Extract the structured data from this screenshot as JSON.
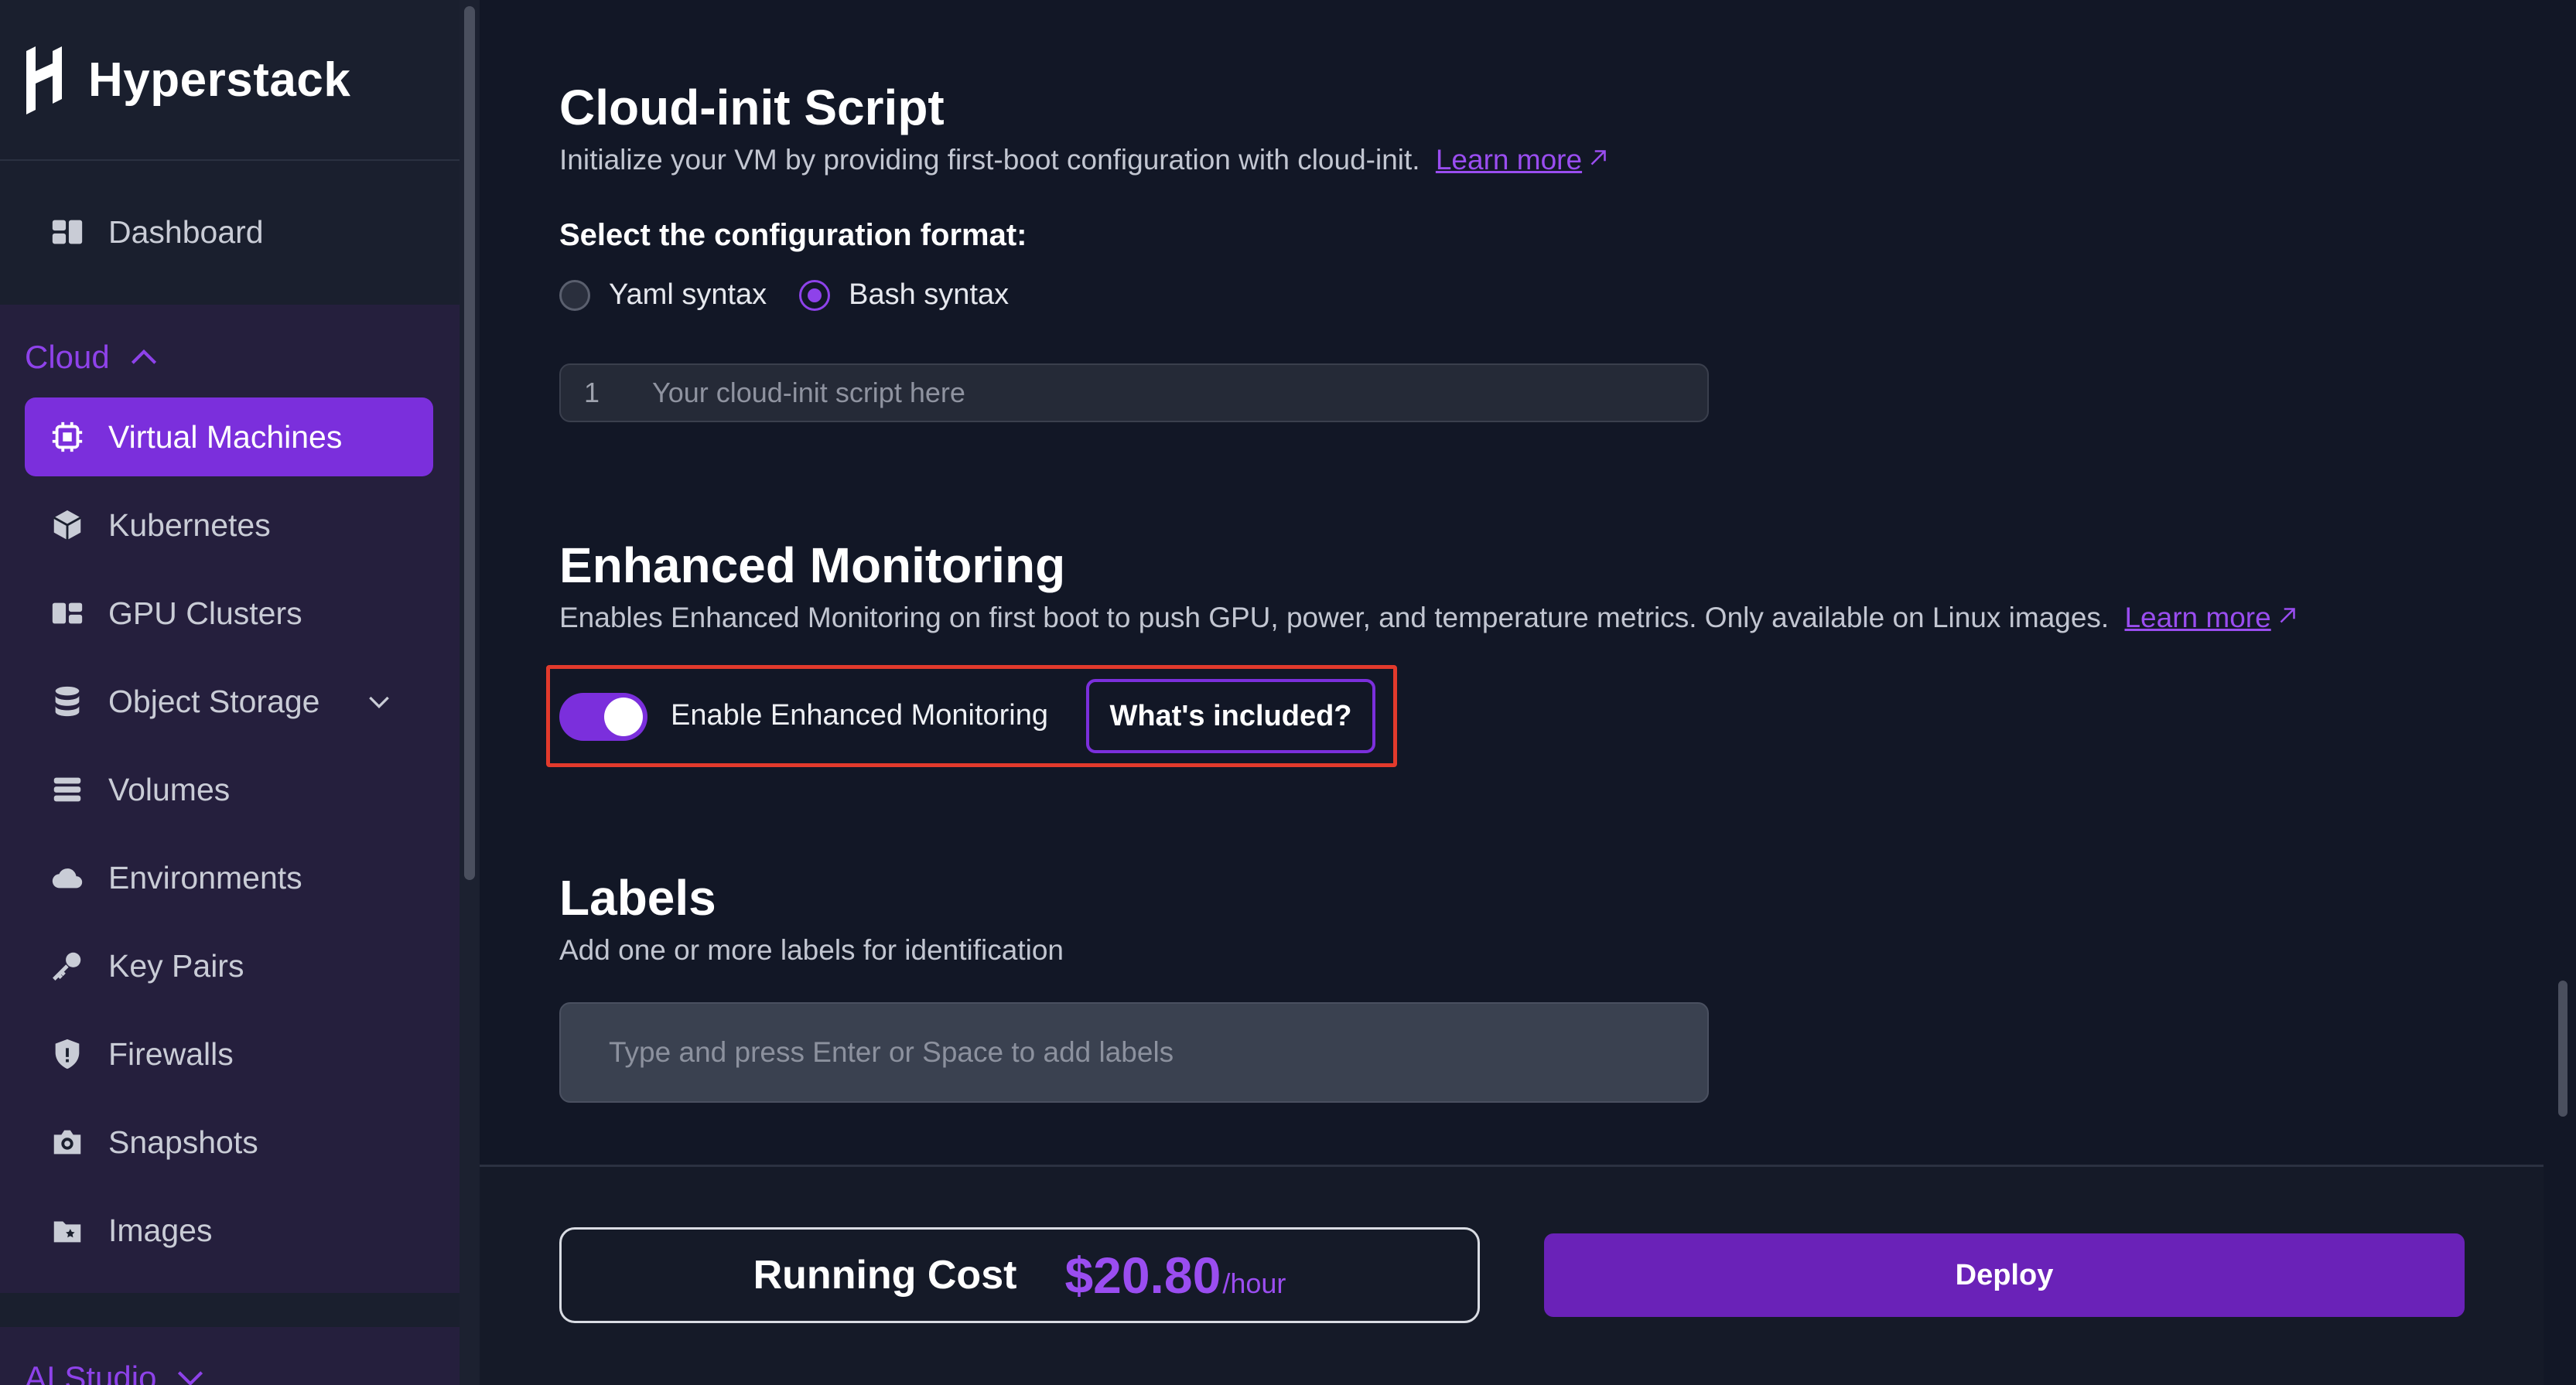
{
  "brand": {
    "name": "Hyperstack"
  },
  "sidebar": {
    "dashboard": {
      "label": "Dashboard",
      "icon": "dashboard-icon"
    },
    "cloud_group": {
      "label": "Cloud",
      "expanded": true
    },
    "cloud_items": [
      {
        "label": "Virtual Machines",
        "icon": "cpu-chip-icon",
        "active": true
      },
      {
        "label": "Kubernetes",
        "icon": "cube-icon"
      },
      {
        "label": "GPU Clusters",
        "icon": "cluster-icon"
      },
      {
        "label": "Object Storage",
        "icon": "database-icon",
        "has_submenu": true
      },
      {
        "label": "Volumes",
        "icon": "volumes-icon"
      },
      {
        "label": "Environments",
        "icon": "cloud-icon"
      },
      {
        "label": "Key Pairs",
        "icon": "key-icon"
      },
      {
        "label": "Firewalls",
        "icon": "shield-icon"
      },
      {
        "label": "Snapshots",
        "icon": "camera-icon"
      },
      {
        "label": "Images",
        "icon": "image-icon"
      }
    ],
    "ai_group": {
      "label": "AI Studio"
    }
  },
  "cloud_init": {
    "title": "Cloud-init Script",
    "description": "Initialize your VM by providing first-boot configuration with cloud-init.",
    "learn_more": "Learn more",
    "format_label": "Select the configuration format:",
    "formats": [
      {
        "label": "Yaml syntax",
        "selected": false
      },
      {
        "label": "Bash syntax",
        "selected": true
      }
    ],
    "editor_line_number": "1",
    "editor_placeholder": "Your cloud-init script here"
  },
  "monitoring": {
    "title": "Enhanced Monitoring",
    "description": "Enables Enhanced Monitoring on first boot to push GPU, power, and temperature metrics. Only available on Linux images.",
    "learn_more": "Learn more",
    "toggle_label": "Enable Enhanced Monitoring",
    "toggle_on": true,
    "included_button": "What's included?"
  },
  "labels": {
    "title": "Labels",
    "description": "Add one or more labels for identification",
    "placeholder": "Type and press Enter or Space to add labels"
  },
  "footer": {
    "cost_label": "Running Cost",
    "cost_value": "$20.80",
    "cost_unit": "/hour",
    "deploy_label": "Deploy"
  },
  "colors": {
    "accent": "#7b2fdc",
    "link": "#9a4df0",
    "highlight": "#e23a2c",
    "background": "#121726"
  }
}
